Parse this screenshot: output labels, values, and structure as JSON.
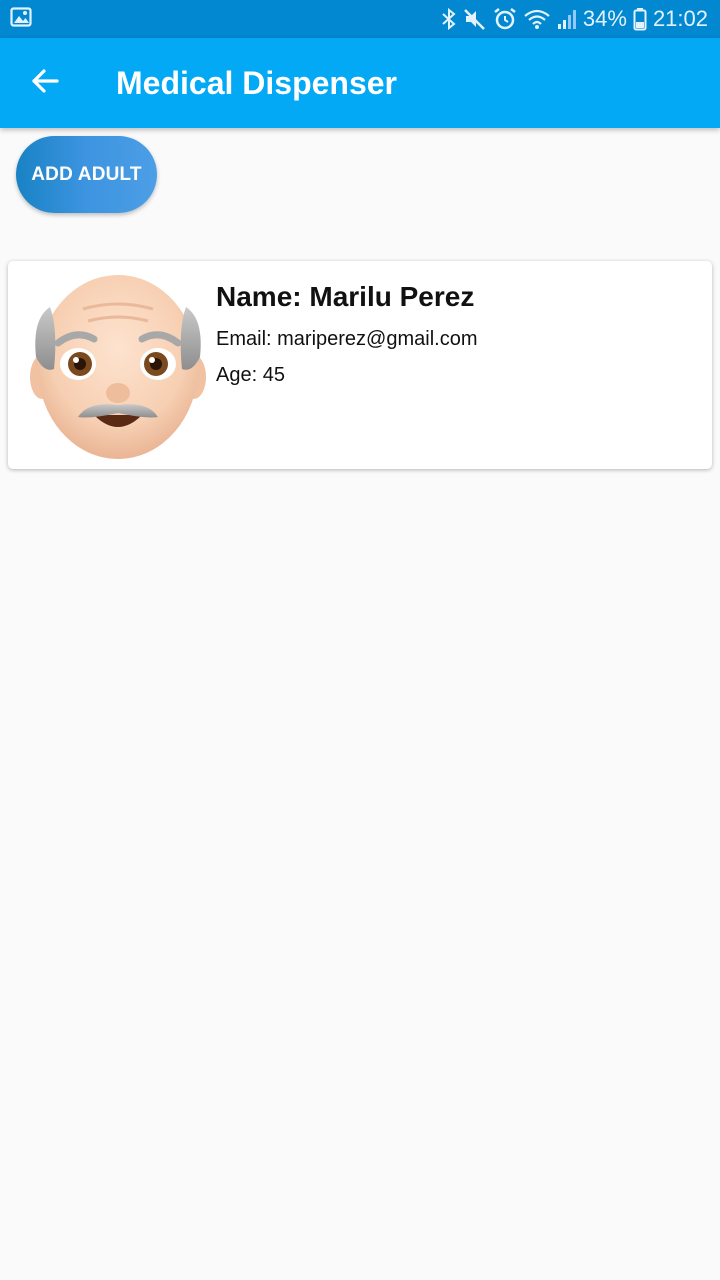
{
  "status_bar": {
    "battery_percent": "34%",
    "time": "21:02",
    "icons": [
      "gallery-icon",
      "bluetooth-icon",
      "mute-icon",
      "alarm-icon",
      "wifi-icon",
      "signal-icon",
      "battery-icon"
    ]
  },
  "app_bar": {
    "title": "Medical Dispenser",
    "back_icon": "arrow-back-icon",
    "background_color": "#03a9f4"
  },
  "add_button": {
    "label": "ADD ADULT"
  },
  "adults": [
    {
      "name": "Name: Marilu Perez",
      "email": "Email: mariperez@gmail.com",
      "age": "Age: 45",
      "avatar_icon": "old-man-emoji-icon"
    }
  ]
}
